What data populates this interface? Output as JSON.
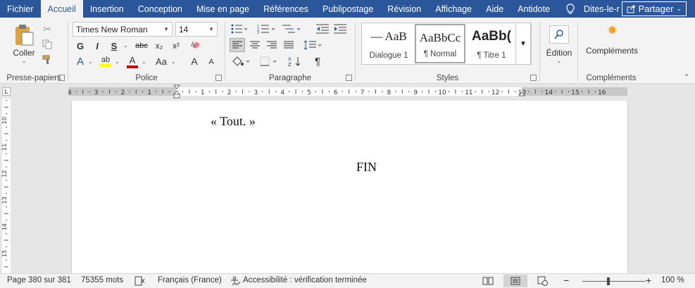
{
  "tabs": [
    "Fichier",
    "Accueil",
    "Insertion",
    "Conception",
    "Mise en page",
    "Références",
    "Publipostage",
    "Révision",
    "Affichage",
    "Aide",
    "Antidote"
  ],
  "active_tab": "Accueil",
  "tell_me": "Dites-le-r",
  "share_label": "Partager",
  "clipboard": {
    "paste_label": "Coller",
    "group_label": "Presse-papiers"
  },
  "font": {
    "name": "Times New Roman",
    "size": "14",
    "group_label": "Police",
    "bold": "G",
    "italic": "I",
    "underline": "S",
    "strike": "abc",
    "subscript": "x₂",
    "superscript": "x²",
    "case": "Aa",
    "grow": "A",
    "shrink": "A"
  },
  "paragraph": {
    "group_label": "Paragraphe",
    "pilcrow": "¶"
  },
  "styles": {
    "group_label": "Styles",
    "items": [
      {
        "preview": "— AaB",
        "name": "Dialogue 1"
      },
      {
        "preview": "AaBbCc",
        "name": "¶ Normal"
      },
      {
        "preview": "AaBb(",
        "name": "¶ Titre 1"
      }
    ]
  },
  "editing": {
    "label": "Édition"
  },
  "addins": {
    "label": "Compléments",
    "group_label": "Compléments"
  },
  "ruler": {
    "corner": "L",
    "left_labels": [
      "4",
      "3",
      "2",
      "1"
    ],
    "right_labels": [
      "1",
      "2",
      "3",
      "4",
      "5",
      "6",
      "7",
      "8",
      "9",
      "10",
      "11",
      "12",
      "13",
      "14",
      "15",
      "16"
    ],
    "vertical_labels": [
      "10",
      "11",
      "12",
      "13",
      "14",
      "15"
    ]
  },
  "document": {
    "line1": "« Tout. »",
    "line2": "FIN"
  },
  "status": {
    "page": "Page 380 sur 381",
    "words": "75355 mots",
    "language": "Français (France)",
    "accessibility": "Accessibilité : vérification terminée",
    "zoom": "100 %",
    "zoom_level_percent": 100
  },
  "colors": {
    "accent": "#2b579a",
    "highlight": "#ffff00",
    "font_color": "#c00000",
    "addin_dot": "#f4a020"
  }
}
